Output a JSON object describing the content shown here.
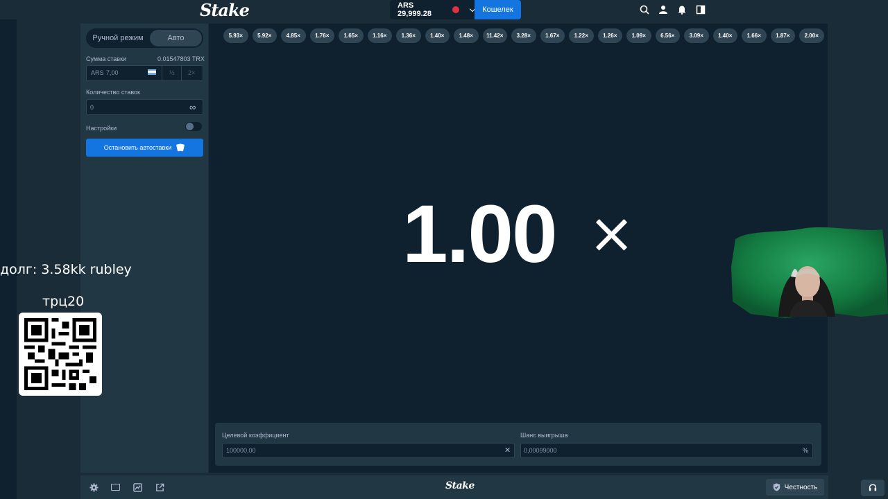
{
  "header": {
    "logo": "Stake",
    "balance": "ARS 29,999.28",
    "wallet_label": "Кошелек",
    "icons": [
      "search-icon",
      "user-icon",
      "bell-icon",
      "sidebar-icon"
    ]
  },
  "sidebar": {
    "modes": [
      "Ручной режим",
      "Авто"
    ],
    "active_mode": "Авто",
    "bet_amount_label": "Сумма ставки",
    "bet_amount_crypto": "0.01547803 TRX",
    "bet_currency": "ARS",
    "bet_value": "7,00",
    "half_label": "½",
    "double_label": "2×",
    "num_bets_label": "Количество ставок",
    "num_bets_value": "0",
    "settings_label": "Настройки",
    "stop_button": "Остановить автоставки"
  },
  "game": {
    "history": [
      "5.93×",
      "5.92×",
      "4.85×",
      "1.76×",
      "1.65×",
      "1.16×",
      "1.36×",
      "1.40×",
      "1.48×",
      "11.42×",
      "3.28×",
      "1.67×",
      "1.22×",
      "1.26×",
      "1.09×",
      "6.56×",
      "3.09×",
      "1.40×",
      "1.66×",
      "1.87×",
      "2.00×"
    ],
    "multiplier": "1.00",
    "multiplier_suffix": "×",
    "target_label": "Целевой коэффициент",
    "target_value": "100000,00",
    "chance_label": "Шанс выигрыша",
    "chance_value": "0,00099000",
    "chance_unit": "%"
  },
  "footer": {
    "logo": "Stake",
    "fairness_label": "Честность"
  },
  "overlay": {
    "debt_text": "долг: 3.58kk rubley",
    "handle_text": "трц20"
  },
  "colors": {
    "bg": "#1a2c38",
    "panel": "#213743",
    "dark": "#0f212e",
    "accent": "#1475e1",
    "chip": "#2f4553"
  }
}
